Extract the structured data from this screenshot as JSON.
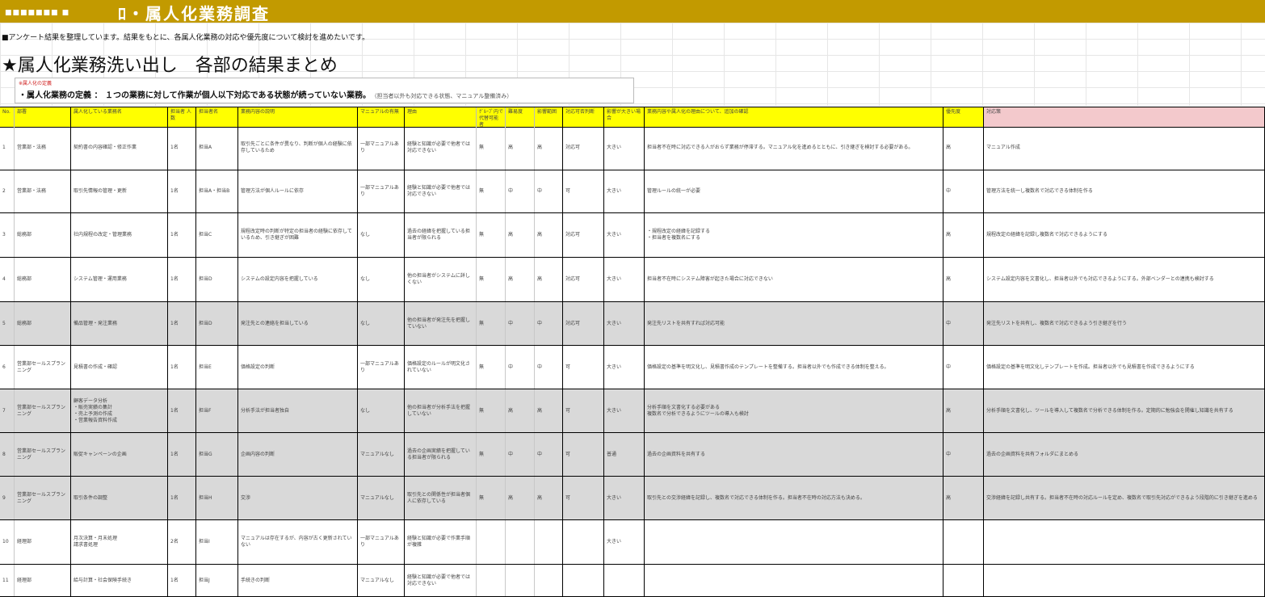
{
  "banner": {
    "left_text": "■■■■■■■ ■",
    "title": "ﾛ・属人化業務調査"
  },
  "intro_text": "■アンケート結果を整理しています。結果をもとに、各属人化業務の対応や優先度について検討を進めたいです。",
  "section_title": "★属人化業務洗い出し　各部の結果まとめ",
  "note": {
    "red_label": "※属人化の定義",
    "definition": "・属人化業務の定義 ： １つの業務に対して作業が個人以下対応である状態が続っていない業務。",
    "extra": "（担当者以外も対応できる状態、マニュアル整備済み）"
  },
  "table": {
    "headers": [
      "No.",
      "部署",
      "属人化している業務名",
      "担当者\n人数",
      "担当者名",
      "業務内容の説明",
      "マニュアルの有無",
      "理由",
      "ｸﾞﾙｰﾌﾟ内で代替可能\n者",
      "難易度",
      "影響範囲",
      "対応可否判断",
      "影響が大きい場合",
      "業務内容や属人化の理由について、追加の確認",
      "優先度",
      "対応策"
    ],
    "rows": [
      {
        "no": "1",
        "dept": "営業部・法務",
        "task": "契約書の内容確認・修正作業",
        "count": "1名",
        "owner": "担当A",
        "desc": "取引先ごとに条件が異なり、判断が個人の経験に依存しているため",
        "manual": "一部マニュアルあり",
        "reason": "経験と知識が必要で他者では対応できない",
        "alt": "無",
        "diff": "高",
        "impact": "高",
        "judge": "対応可",
        "big": "大きい",
        "note": "担当者不在時に対応できる人がおらず業務が停滞する。マニュアル化を進めるとともに、引き継ぎを検討する必要がある。",
        "priority": "高",
        "action": "マニュアル作成"
      },
      {
        "no": "2",
        "dept": "営業部・法務",
        "task": "取引先情報の管理・更新",
        "count": "1名",
        "owner": "担当A・担当B",
        "desc": "管理方法が個人ルールに依存",
        "manual": "一部マニュアルあり",
        "reason": "経験と知識が必要で他者では対応できない",
        "alt": "無",
        "diff": "中",
        "impact": "中",
        "judge": "可",
        "big": "大きい",
        "note": "管理ルールの統一が必要",
        "priority": "中",
        "action": "管理方法を統一し複数名で対応できる体制を作る"
      },
      {
        "no": "3",
        "dept": "総務部",
        "task": "社内規程の改定・管理業務",
        "count": "1名",
        "owner": "担当C",
        "desc": "規程改定時の判断が特定の担当者の経験に依存しているため、引き継ぎが困難",
        "manual": "なし",
        "reason": "過去の経緯を把握している担当者が限られる",
        "alt": "無",
        "diff": "高",
        "impact": "高",
        "judge": "対応可",
        "big": "大きい",
        "note": "・規程改定の経緯を記録する\n・担当者を複数名にする",
        "priority": "高",
        "action": "規程改定の経緯を記録し複数名で対応できるようにする"
      },
      {
        "no": "4",
        "dept": "総務部",
        "task": "システム管理・運用業務",
        "count": "1名",
        "owner": "担当D",
        "desc": "システムの設定内容を把握している",
        "manual": "なし",
        "reason": "他の担当者がシステムに詳しくない",
        "alt": "無",
        "diff": "高",
        "impact": "高",
        "judge": "対応可",
        "big": "大きい",
        "note": "担当者不在時にシステム障害が起きた場合に対応できない",
        "priority": "高",
        "action": "システム設定内容を文書化し、担当者以外でも対応できるようにする。外部ベンダーとの連携も検討する"
      },
      {
        "no": "5",
        "dept": "総務部",
        "task": "備品管理・発注業務",
        "count": "1名",
        "owner": "担当D",
        "desc": "発注先との連絡を担当している",
        "manual": "なし",
        "reason": "他の担当者が発注先を把握していない",
        "alt": "無",
        "diff": "中",
        "impact": "中",
        "judge": "対応可",
        "big": "大きい",
        "note": "発注先リストを共有すれば対応可能",
        "priority": "中",
        "action": "発注先リストを共有し、複数名で対応できるよう引き継ぎを行う"
      },
      {
        "no": "6",
        "dept": "営業部セールスプランニング",
        "task": "見積書の作成・確認",
        "count": "1名",
        "owner": "担当E",
        "desc": "価格設定の判断",
        "manual": "一部マニュアルあり",
        "reason": "価格設定のルールが明文化されていない",
        "alt": "無",
        "diff": "中",
        "impact": "中",
        "judge": "可",
        "big": "大きい",
        "note": "価格設定の基準を明文化し、見積書作成のテンプレートを整備する。担当者以外でも作成できる体制を整える。",
        "priority": "中",
        "action": "価格設定の基準を明文化しテンプレートを作成。担当者以外でも見積書を作成できるようにする"
      },
      {
        "no": "7",
        "dept": "営業部セールスプランニング",
        "task": "顧客データ分析\n・販売実績の集計\n・売上予測の作成\n・営業報告資料作成",
        "count": "1名",
        "owner": "担当F",
        "desc": "分析手法が担当者独自",
        "manual": "なし",
        "reason": "他の担当者が分析手法を把握していない",
        "alt": "無",
        "diff": "高",
        "impact": "高",
        "judge": "可",
        "big": "大きい",
        "note": "分析手順を文書化する必要がある\n複数名で分析できるようにツールの導入も検討",
        "priority": "高",
        "action": "分析手順を文書化し、ツールを導入して複数名で分析できる体制を作る。定期的に勉強会を開催し知識を共有する"
      },
      {
        "no": "8",
        "dept": "営業部セールスプランニング",
        "task": "販促キャンペーンの企画",
        "count": "1名",
        "owner": "担当G",
        "desc": "企画内容の判断",
        "manual": "マニュアルなし",
        "reason": "過去の企画実績を把握している担当者が限られる",
        "alt": "無",
        "diff": "中",
        "impact": "中",
        "judge": "可",
        "big": "普通",
        "note": "過去の企画資料を共有する",
        "priority": "中",
        "action": "過去の企画資料を共有フォルダにまとめる"
      },
      {
        "no": "9",
        "dept": "営業部セールスプランニング",
        "task": "取引条件の調整",
        "count": "1名",
        "owner": "担当H",
        "desc": "交渉",
        "manual": "マニュアルなし",
        "reason": "取引先との関係性が担当者個人に依存している",
        "alt": "無",
        "diff": "高",
        "impact": "高",
        "judge": "可",
        "big": "大きい",
        "note": "取引先との交渉経緯を記録し、複数名で対応できる体制を作る。担当者不在時の対応方法も決める。",
        "priority": "高",
        "action": "交渉経緯を記録し共有する。担当者不在時の対応ルールを定め、複数名で取引先対応ができるよう段階的に引き継ぎを進める"
      },
      {
        "no": "10",
        "dept": "経理部",
        "task": "月次決算・月末処理\n請求書処理",
        "count": "2名",
        "owner": "担当I",
        "desc": "マニュアルは存在するが、内容が古く更新されていない",
        "manual": "一部マニュアルあり",
        "reason": "経験と知識が必要で作業手順が複雑",
        "alt": "",
        "diff": "",
        "impact": "",
        "judge": "",
        "big": "大きい",
        "note": "",
        "priority": "",
        "action": ""
      },
      {
        "no": "11",
        "dept": "経理部",
        "task": "給与計算・社会保険手続き",
        "count": "1名",
        "owner": "担当J",
        "desc": "手続きの判断",
        "manual": "マニュアルなし",
        "reason": "経験と知識が必要で他者では対応できない",
        "alt": "",
        "diff": "",
        "impact": "",
        "judge": "",
        "big": "",
        "note": "",
        "priority": "",
        "action": ""
      }
    ]
  }
}
